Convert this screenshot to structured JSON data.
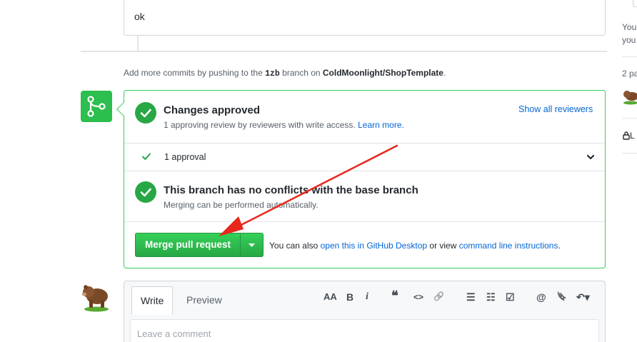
{
  "previous_comment": {
    "text": "ok"
  },
  "push_note": {
    "prefix": "Add more commits by pushing to the",
    "branch": "1zb",
    "middle": "branch on",
    "repo": "ColdMoonlight/ShopTemplate",
    "suffix": "."
  },
  "review": {
    "title": "Changes approved",
    "subtitle": "1 approving review by reviewers with write access.",
    "learn_more": "Learn more.",
    "show_all": "Show all reviewers",
    "approval_count": "1 approval"
  },
  "conflicts": {
    "title": "This branch has no conflicts with the base branch",
    "subtitle": "Merging can be performed automatically."
  },
  "merge": {
    "button_label": "Merge pull request",
    "also_prefix": "You can also",
    "desktop_link": "open this in GitHub Desktop",
    "or_view": "or view",
    "cli_link": "command line instructions",
    "suffix": "."
  },
  "editor": {
    "tab_write": "Write",
    "tab_preview": "Preview",
    "toolbar": {
      "heading": "AA",
      "bold": "B",
      "italic": "i",
      "quote": "❝",
      "code": "<>",
      "link": "🔗",
      "bullet_list": "☰",
      "numbered_list": "☷",
      "task_list": "☑",
      "mention": "@",
      "saved_reply": "🔖",
      "reply": "↶▾"
    },
    "placeholder": "Leave a comment"
  },
  "sidebar": {
    "line1": "You",
    "line2": "you",
    "participants": "2 pa",
    "lock_label": "L"
  },
  "colors": {
    "success": "#28a745",
    "link": "#0366d6",
    "annotation_arrow": "#e8261c"
  }
}
